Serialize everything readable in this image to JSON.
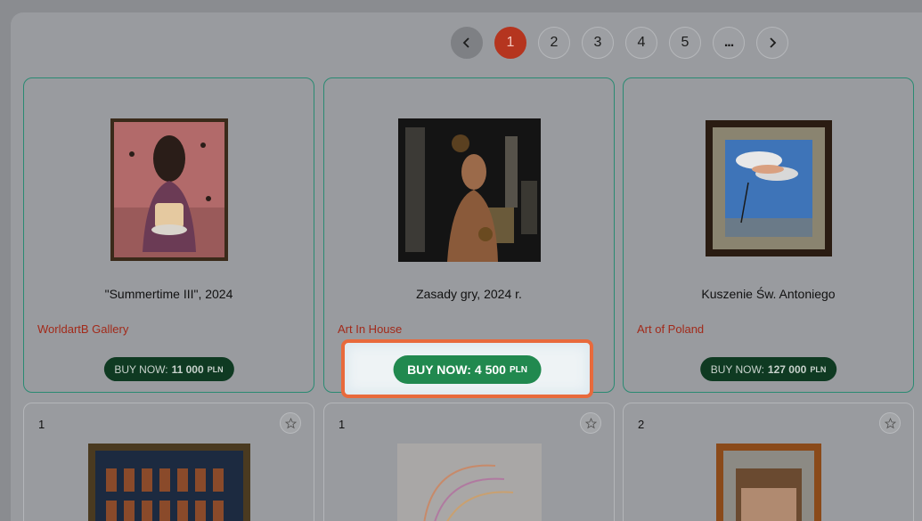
{
  "pagination": {
    "prev_icon": "chevron-left-icon",
    "pages": [
      "1",
      "2",
      "3",
      "4",
      "5",
      "..."
    ],
    "active": "1",
    "next_icon": "chevron-right-icon"
  },
  "cards": [
    {
      "title": "\"Summertime III\", 2024",
      "gallery": "WorldartB Gallery",
      "buy_label": "BUY NOW:",
      "price": "11 000",
      "currency": "PLN"
    },
    {
      "title": "Zasady gry, 2024 r.",
      "gallery": "Art In House",
      "buy_label": "BUY NOW:",
      "price": "4 500",
      "currency": "PLN"
    },
    {
      "title": "Kuszenie Św. Antoniego",
      "gallery": "Art of Poland",
      "buy_label": "BUY NOW:",
      "price": "127 000",
      "currency": "PLN"
    }
  ],
  "row2": [
    {
      "count": "1"
    },
    {
      "count": "1"
    },
    {
      "count": "2"
    }
  ],
  "colors": {
    "accent": "#b5351f",
    "buy_dark": "#0f3a22",
    "buy_highlight": "#21894f",
    "highlight_border": "#e86a3c"
  }
}
